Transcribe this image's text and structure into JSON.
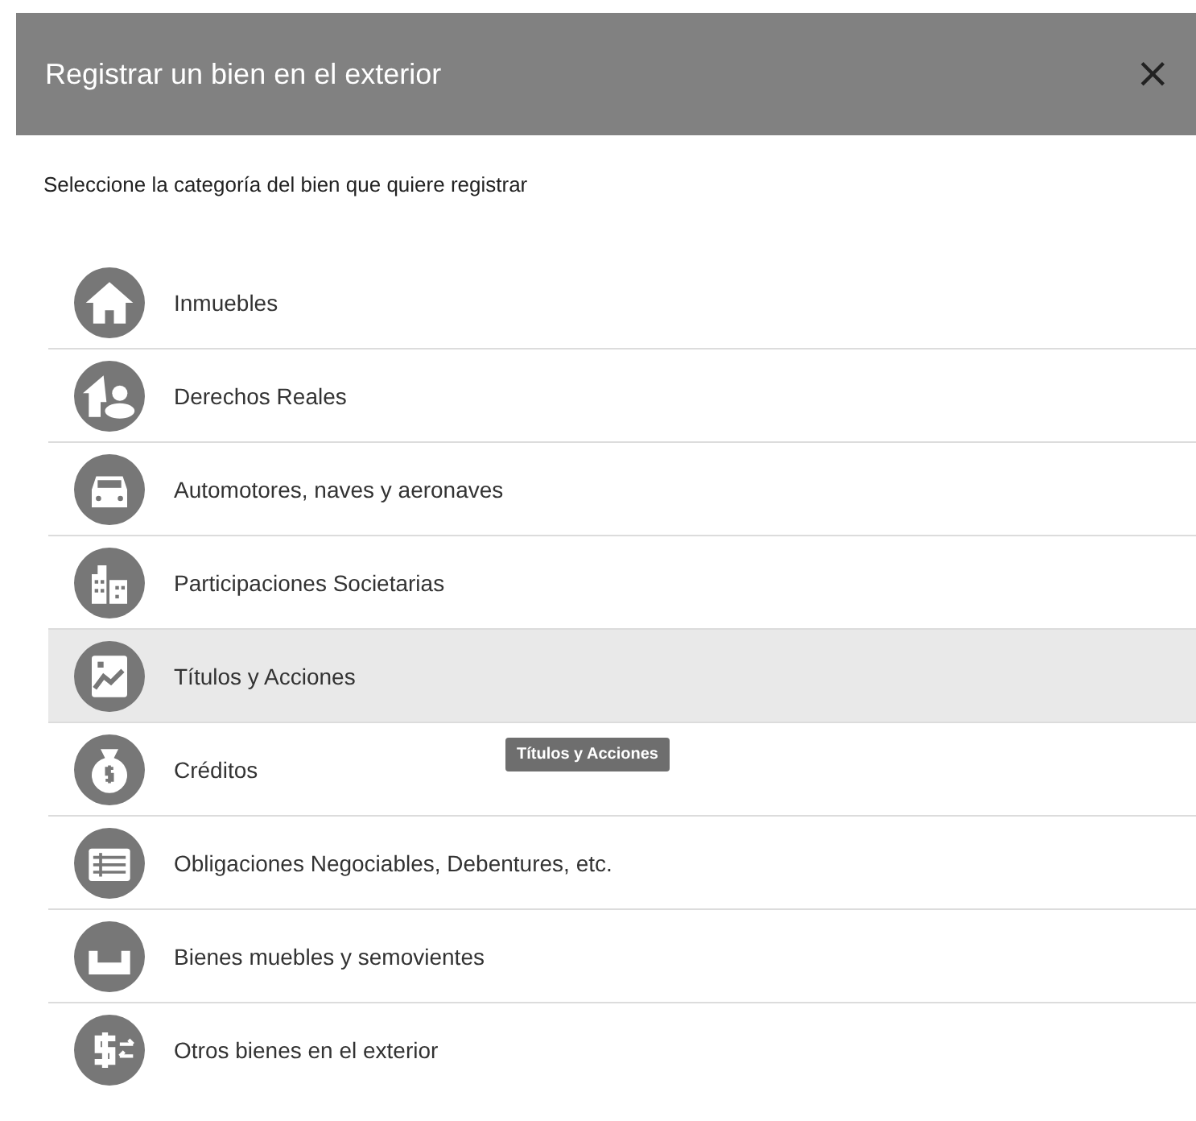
{
  "dialog": {
    "title": "Registrar un bien en el exterior",
    "close": "×"
  },
  "prompt": "Seleccione la categoría del bien que quiere registrar",
  "categories": [
    {
      "label": "Inmuebles",
      "selected": false
    },
    {
      "label": "Derechos Reales",
      "selected": false
    },
    {
      "label": "Automotores, naves y aeronaves",
      "selected": false
    },
    {
      "label": "Participaciones Societarias",
      "selected": false
    },
    {
      "label": "Títulos y Acciones",
      "selected": true
    },
    {
      "label": "Créditos",
      "selected": false
    },
    {
      "label": "Obligaciones Negociables, Debentures, etc.",
      "selected": false
    },
    {
      "label": "Bienes muebles y semovientes",
      "selected": false
    },
    {
      "label": "Otros bienes en el exterior",
      "selected": false
    }
  ],
  "tooltip": "Títulos y Acciones"
}
